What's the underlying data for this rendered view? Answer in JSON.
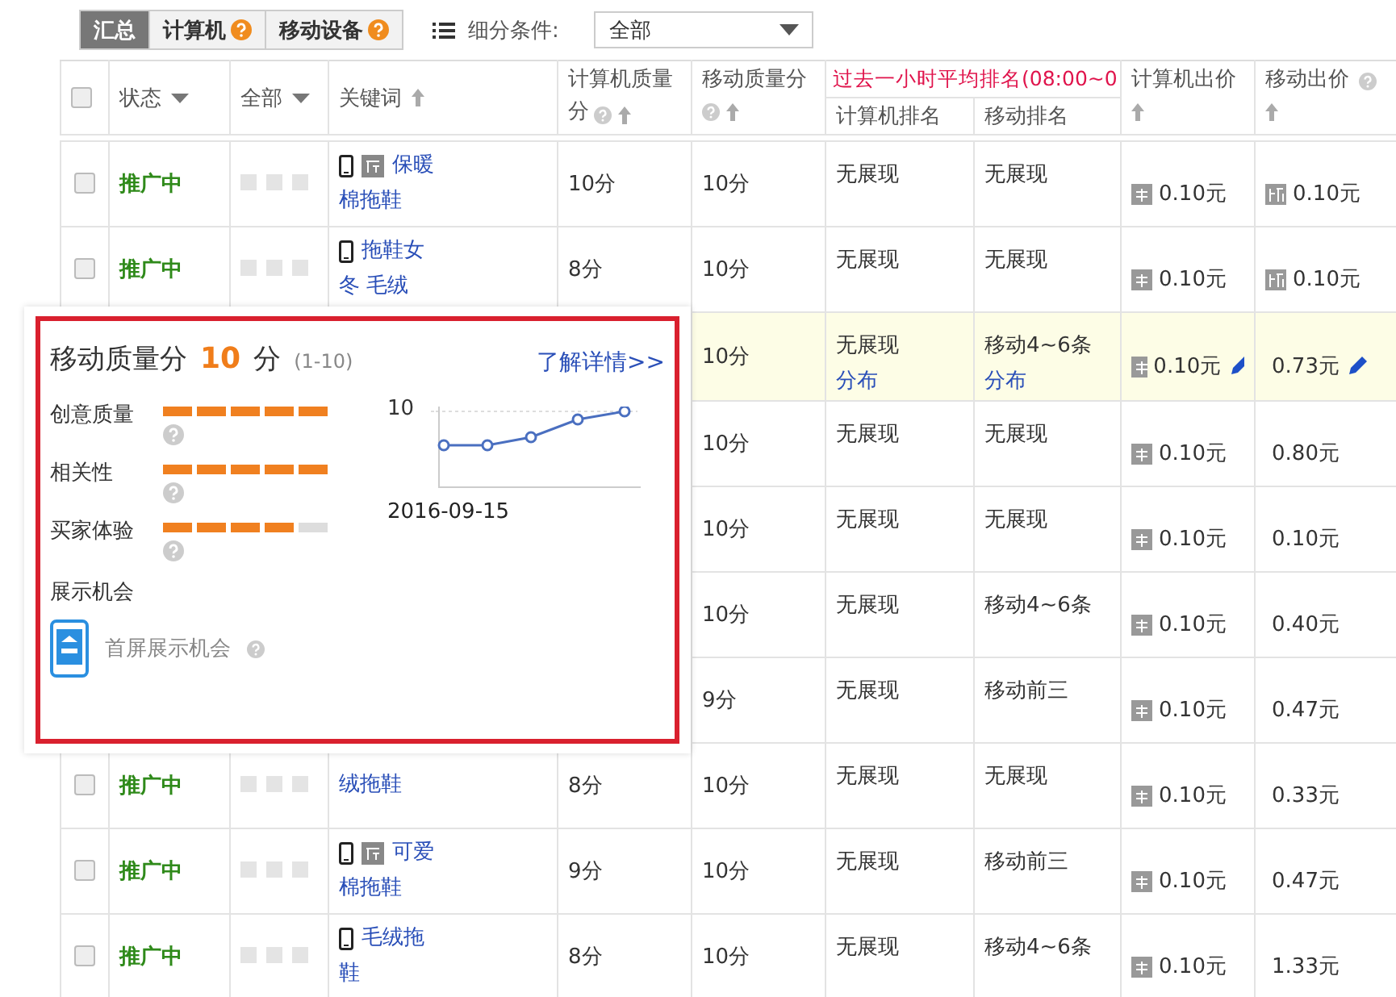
{
  "tabs": [
    {
      "label": "汇总",
      "selected": true,
      "help": false
    },
    {
      "label": "计算机",
      "selected": false,
      "help": true
    },
    {
      "label": "移动设备",
      "selected": false,
      "help": true
    }
  ],
  "filter": {
    "label": "细分条件:",
    "value": "全部"
  },
  "columns": {
    "select_all_checked": false,
    "status": "状态",
    "all": "全部",
    "keyword": "关键词",
    "pc_quality": "计算机质量分",
    "mobile_quality": "移动质量分",
    "rank_group": "过去一小时平均排名(08:00~0",
    "pc_rank": "计算机排名",
    "mobile_rank": "移动排名",
    "pc_bid": "计算机出价",
    "mobile_bid": "移动出价"
  },
  "rows": [
    {
      "checked": false,
      "status": "推广中",
      "keyword": [
        "保暖",
        "棉拖鞋"
      ],
      "device_icon": true,
      "tag_icon": true,
      "pc_quality": "10分",
      "mobile_quality": "10分",
      "pc_rank": "无展现",
      "mobile_rank": "无展现",
      "pc_bid": "0.10元",
      "mobile_bid": "0.10元",
      "mobile_bid_icon": true,
      "editable": false,
      "highlighted": false
    },
    {
      "checked": false,
      "status": "推广中",
      "keyword": [
        "拖鞋女",
        "冬 毛绒"
      ],
      "device_icon": true,
      "tag_icon": false,
      "pc_quality": "8分",
      "mobile_quality": "10分",
      "pc_rank": "无展现",
      "mobile_rank": "无展现",
      "pc_bid": "0.10元",
      "mobile_bid": "0.10元",
      "mobile_bid_icon": true,
      "editable": false,
      "highlighted": false
    },
    {
      "mobile_quality": "10分",
      "pc_rank": "无展现",
      "pc_rank_link": "分布",
      "mobile_rank": "移动4~6条",
      "mobile_rank_link": "分布",
      "pc_bid": "0.10元",
      "mobile_bid": "0.73元",
      "mobile_bid_icon": false,
      "editable": true,
      "highlighted": true
    },
    {
      "mobile_quality": "10分",
      "pc_rank": "无展现",
      "mobile_rank": "无展现",
      "pc_bid": "0.10元",
      "mobile_bid": "0.80元",
      "mobile_bid_icon": false,
      "editable": false,
      "highlighted": false
    },
    {
      "mobile_quality": "10分",
      "pc_rank": "无展现",
      "mobile_rank": "无展现",
      "pc_bid": "0.10元",
      "mobile_bid": "0.10元",
      "mobile_bid_icon": false,
      "editable": false,
      "highlighted": false
    },
    {
      "mobile_quality": "10分",
      "pc_rank": "无展现",
      "mobile_rank": "移动4~6条",
      "pc_bid": "0.10元",
      "mobile_bid": "0.40元",
      "mobile_bid_icon": false,
      "editable": false,
      "highlighted": false
    },
    {
      "mobile_quality": "9分",
      "pc_rank": "无展现",
      "mobile_rank": "移动前三",
      "pc_bid": "0.10元",
      "mobile_bid": "0.47元",
      "mobile_bid_icon": false,
      "editable": false,
      "highlighted": false
    },
    {
      "checked": false,
      "status": "推广中",
      "keyword": [
        "绒拖鞋"
      ],
      "device_icon": false,
      "tag_icon": false,
      "pc_quality": "8分",
      "mobile_quality": "10分",
      "pc_rank": "无展现",
      "mobile_rank": "无展现",
      "pc_bid": "0.10元",
      "mobile_bid": "0.33元",
      "mobile_bid_icon": false,
      "editable": false,
      "highlighted": false
    },
    {
      "checked": false,
      "status": "推广中",
      "keyword": [
        "可爱",
        "棉拖鞋"
      ],
      "device_icon": true,
      "tag_icon": true,
      "pc_quality": "9分",
      "mobile_quality": "10分",
      "pc_rank": "无展现",
      "mobile_rank": "移动前三",
      "pc_bid": "0.10元",
      "mobile_bid": "0.47元",
      "mobile_bid_icon": false,
      "editable": false,
      "highlighted": false
    },
    {
      "checked": false,
      "status": "推广中",
      "keyword": [
        "毛绒拖",
        "鞋"
      ],
      "device_icon": true,
      "tag_icon": false,
      "pc_quality": "8分",
      "mobile_quality": "10分",
      "pc_rank": "无展现",
      "mobile_rank": "移动4~6条",
      "pc_bid": "0.10元",
      "mobile_bid": "1.33元",
      "mobile_bid_icon": false,
      "editable": false,
      "highlighted": false
    }
  ],
  "popup": {
    "title": "移动质量分",
    "score": "10",
    "unit": "分",
    "range": "(1-10)",
    "link": "了解详情>>",
    "metrics": [
      {
        "label": "创意质量",
        "stars": 5
      },
      {
        "label": "相关性",
        "stars": 5
      },
      {
        "label": "买家体验",
        "stars": 4
      }
    ],
    "trend": {
      "top_label": "10",
      "date": "2016-09-15"
    },
    "exposure": {
      "title": "展示机会",
      "item": "首屏展示机会"
    }
  }
}
